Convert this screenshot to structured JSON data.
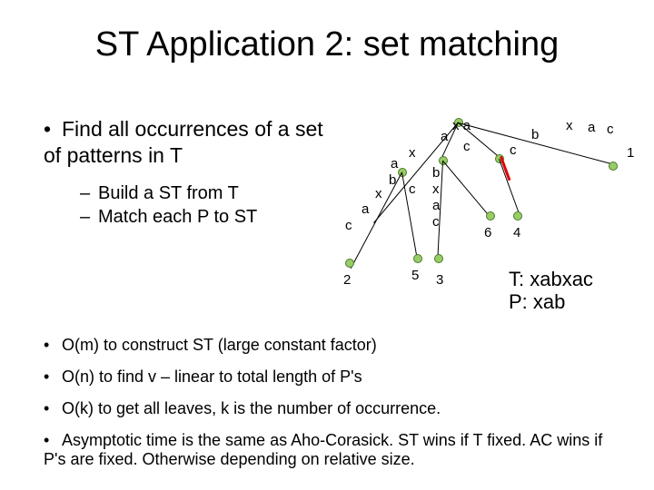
{
  "title": "ST Application 2: set matching",
  "bullet_main": "Find all occurrences of a set of patterns in T",
  "sub1": "Build a ST from T",
  "sub2": "Match each P to ST",
  "lower1": "O(m) to construct ST (large constant factor)",
  "lower2": "O(n) to find v – linear to total length of P's",
  "lower3": "O(k) to get all leaves, k is the number of occurrence.",
  "lower4": "Asymptotic time is the same as Aho-Corasick. ST wins if T fixed. AC wins if P's are fixed. Otherwise depending on relative size.",
  "T_label": "T: xabxac",
  "P_label": "P: xab",
  "tree": {
    "edge_xabxac": "x",
    "edge_a": "a",
    "edge_b": "b",
    "edge_c": "c",
    "edge_bxac": "b",
    "edge_xac": "x",
    "edge_ac": "a",
    "edge_c2": "c",
    "edge_c3": "c",
    "edge_c4": "c",
    "mid_a": "a",
    "mid_x_a": "x a",
    "mid_b": "b",
    "mid_x": "x",
    "mid_a2": "a",
    "mid_c_leaf": "c",
    "leaf2": "2",
    "leaf5": "5",
    "leaf3": "3",
    "leaf6": "6",
    "leaf4": "4",
    "leaf1": "1"
  }
}
